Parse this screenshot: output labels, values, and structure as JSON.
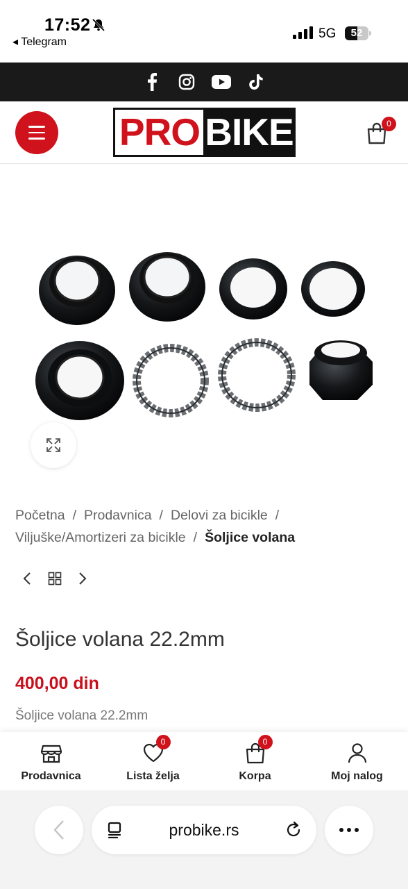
{
  "status_bar": {
    "time": "17:52",
    "back_app": "◂ Telegram",
    "network": "5G",
    "battery": "52",
    "battery_level": 0.52
  },
  "social": {
    "icons": [
      "facebook-icon",
      "instagram-icon",
      "youtube-icon",
      "tiktok-icon"
    ]
  },
  "header": {
    "logo_part1": "PRO",
    "logo_part2": "BIKE",
    "cart_count": "0",
    "brand_color": "#d0121c"
  },
  "breadcrumb": {
    "items": [
      "Početna",
      "Prodavnica",
      "Delovi za bicikle",
      "Viljuške/Amortizeri za bicikle"
    ],
    "separator": "/",
    "current": "Šoljice volana"
  },
  "product": {
    "title": "Šoljice volana 22.2mm",
    "price": "400,00 din",
    "short_description": "Šoljice volana 22.2mm"
  },
  "bottom_nav": {
    "shop": "Prodavnica",
    "wishlist": "Lista želja",
    "wishlist_count": "0",
    "cart": "Korpa",
    "cart_count": "0",
    "account": "Moj nalog"
  },
  "browser": {
    "url": "probike.rs"
  }
}
